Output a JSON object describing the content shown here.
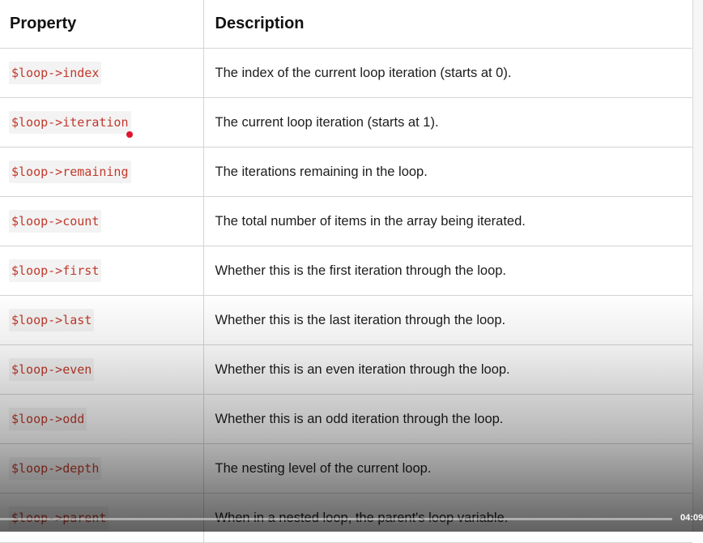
{
  "table": {
    "headers": [
      "Property",
      "Description"
    ],
    "rows": [
      {
        "property": "$loop->index",
        "description": "The index of the current loop iteration (starts at 0)."
      },
      {
        "property": "$loop->iteration",
        "description": "The current loop iteration (starts at 1)."
      },
      {
        "property": "$loop->remaining",
        "description": "The iterations remaining in the loop."
      },
      {
        "property": "$loop->count",
        "description": "The total number of items in the array being iterated."
      },
      {
        "property": "$loop->first",
        "description": "Whether this is the first iteration through the loop."
      },
      {
        "property": "$loop->last",
        "description": "Whether this is the last iteration through the loop."
      },
      {
        "property": "$loop->even",
        "description": "Whether this is an even iteration through the loop."
      },
      {
        "property": "$loop->odd",
        "description": "Whether this is an odd iteration through the loop."
      },
      {
        "property": "$loop->depth",
        "description": "The nesting level of the current loop."
      },
      {
        "property": "$loop->parent",
        "description": "When in a nested loop, the parent's loop variable."
      }
    ]
  },
  "player": {
    "timestamp": "04:09",
    "progress": 0
  },
  "colors": {
    "code_text": "#c0392b",
    "code_bg": "#f3f3f3",
    "cursor_dot": "#e0142d"
  }
}
